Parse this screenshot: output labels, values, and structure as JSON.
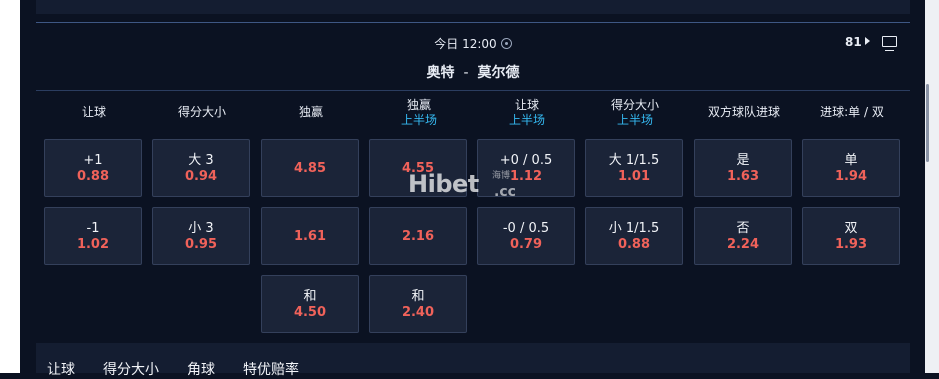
{
  "match": {
    "time": "今日 12:00",
    "market_count": "81",
    "home": "奥特",
    "separator": "-",
    "away": "莫尔德"
  },
  "columns": [
    {
      "label": "让球",
      "sub": ""
    },
    {
      "label": "得分大小",
      "sub": ""
    },
    {
      "label": "独赢",
      "sub": ""
    },
    {
      "label": "独赢",
      "sub": "上半场"
    },
    {
      "label": "让球",
      "sub": "上半场"
    },
    {
      "label": "得分大小",
      "sub": "上半场"
    },
    {
      "label": "双方球队进球",
      "sub": ""
    },
    {
      "label": "进球:单 / 双",
      "sub": ""
    }
  ],
  "rows": [
    [
      {
        "label": "+1",
        "odds": "0.88"
      },
      {
        "label": "大 3",
        "odds": "0.94"
      },
      {
        "label": "",
        "odds": "4.85"
      },
      {
        "label": "",
        "odds": "4.55"
      },
      {
        "label": "+0 / 0.5",
        "odds": "1.12"
      },
      {
        "label": "大 1/1.5",
        "odds": "1.01"
      },
      {
        "label": "是",
        "odds": "1.63"
      },
      {
        "label": "单",
        "odds": "1.94"
      }
    ],
    [
      {
        "label": "-1",
        "odds": "1.02"
      },
      {
        "label": "小 3",
        "odds": "0.95"
      },
      {
        "label": "",
        "odds": "1.61"
      },
      {
        "label": "",
        "odds": "2.16"
      },
      {
        "label": "-0 / 0.5",
        "odds": "0.79"
      },
      {
        "label": "小 1/1.5",
        "odds": "0.88"
      },
      {
        "label": "否",
        "odds": "2.24"
      },
      {
        "label": "双",
        "odds": "1.93"
      }
    ],
    [
      null,
      null,
      {
        "label": "和",
        "odds": "4.50"
      },
      {
        "label": "和",
        "odds": "2.40"
      },
      null,
      null,
      null,
      null
    ]
  ],
  "watermark": {
    "text": "Hibet",
    "sub": "海博",
    "suffix": ".cc"
  },
  "bottom_tabs": [
    "让球",
    "得分大小",
    "角球",
    "特优赔率"
  ],
  "colors": {
    "background": "#0b1222",
    "odds": "#f0625a",
    "sub_label": "#35b8f0",
    "cell": "#1b2438"
  }
}
